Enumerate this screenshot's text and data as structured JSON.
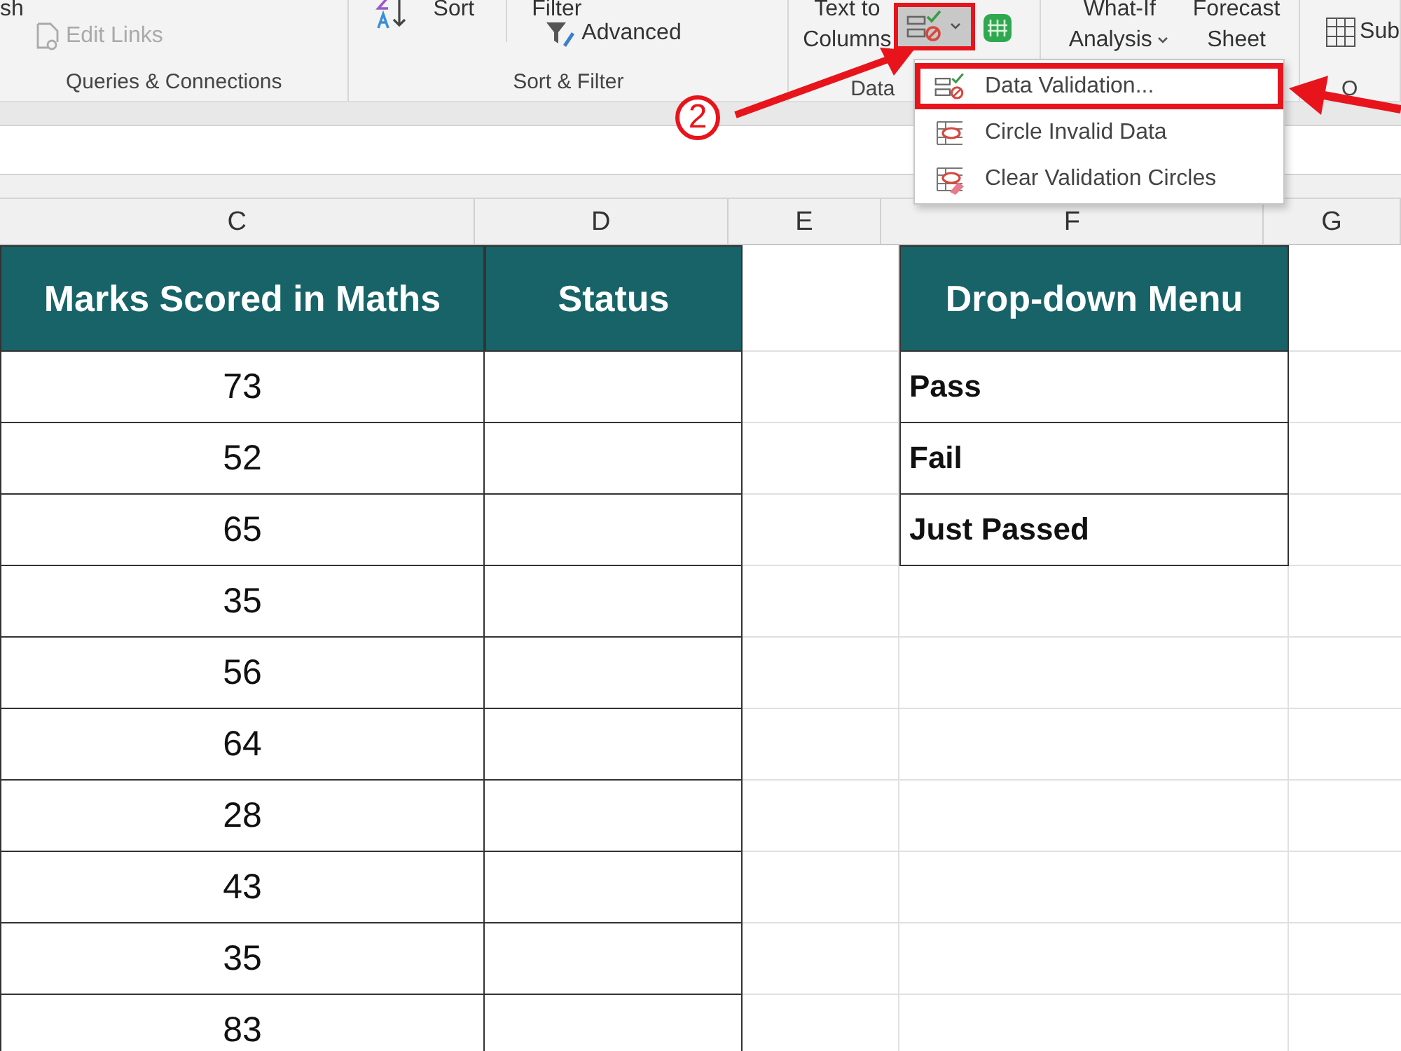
{
  "ribbon": {
    "refresh_label": "sh",
    "edit_links": {
      "label": "Edit Links",
      "disabled": true
    },
    "queries_group": "Queries & Connections",
    "sort": "Sort",
    "filter": "Filter",
    "advanced": "Advanced",
    "sort_group": "Sort & Filter",
    "text_to_columns": [
      "Text to",
      "Columns"
    ],
    "data_validation_button": {
      "selected": true
    },
    "data_group": "Data",
    "what_if": [
      "What-If",
      "Analysis"
    ],
    "forecast": [
      "Forecast",
      "Sheet"
    ],
    "subtotal": "Sub",
    "outline_group": "O"
  },
  "menu": {
    "items": [
      {
        "label": "Data Validation...",
        "kind": "validation",
        "selected": true
      },
      {
        "label": "Circle Invalid Data",
        "kind": "circle",
        "selected": false
      },
      {
        "label": "Clear Validation Circles",
        "kind": "clear",
        "selected": false
      }
    ]
  },
  "annotation": {
    "step": "2"
  },
  "columns": [
    {
      "letter": "C"
    },
    {
      "letter": "D"
    },
    {
      "letter": "E"
    },
    {
      "letter": "F"
    },
    {
      "letter": "G"
    }
  ],
  "table": {
    "headers": {
      "marks": "Marks Scored in Maths",
      "status": "Status"
    },
    "rows": [
      {
        "marks": "73"
      },
      {
        "marks": "52"
      },
      {
        "marks": "65"
      },
      {
        "marks": "35"
      },
      {
        "marks": "56"
      },
      {
        "marks": "64"
      },
      {
        "marks": "28"
      },
      {
        "marks": "43"
      },
      {
        "marks": "35"
      },
      {
        "marks": "83"
      }
    ]
  },
  "dropdown_list": {
    "header": "Drop-down Menu",
    "options": [
      "Pass",
      "Fail",
      "Just Passed"
    ]
  }
}
